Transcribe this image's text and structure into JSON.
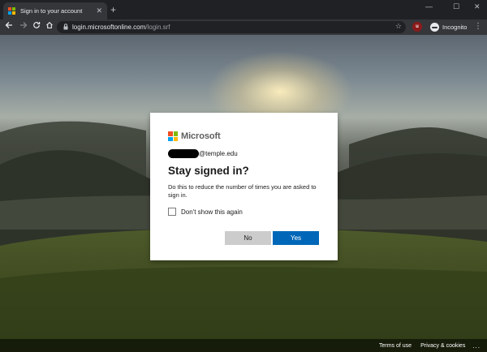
{
  "browser": {
    "tab_title": "Sign in to your account",
    "tab_close": "✕",
    "new_tab": "+",
    "window_controls": {
      "minimize": "—",
      "maximize": "☐",
      "close": "✕"
    },
    "url_host": "login.microsoftonline.com",
    "url_path": "/login.srf",
    "extension_badge": "u",
    "profile_label": "Incognito",
    "icons": [
      "back-arrow-icon",
      "forward-arrow-icon",
      "reload-icon",
      "home-icon",
      "lock-icon",
      "star-icon",
      "extension-icon",
      "incognito-icon",
      "kebab-menu-icon"
    ]
  },
  "dialog": {
    "brand": "Microsoft",
    "email_domain": "@temple.edu",
    "title": "Stay signed in?",
    "description": "Do this to reduce the number of times you are asked to sign in.",
    "checkbox_label": "Don't show this again",
    "checkbox_checked": false,
    "no_label": "No",
    "yes_label": "Yes"
  },
  "footer": {
    "terms": "Terms of use",
    "privacy": "Privacy & cookies",
    "more": "..."
  },
  "colors": {
    "ms_red": "#f25022",
    "ms_green": "#7fba00",
    "ms_blue": "#00a4ef",
    "ms_yellow": "#ffb900",
    "primary_button": "#0067b8",
    "secondary_button": "#cccccc"
  }
}
